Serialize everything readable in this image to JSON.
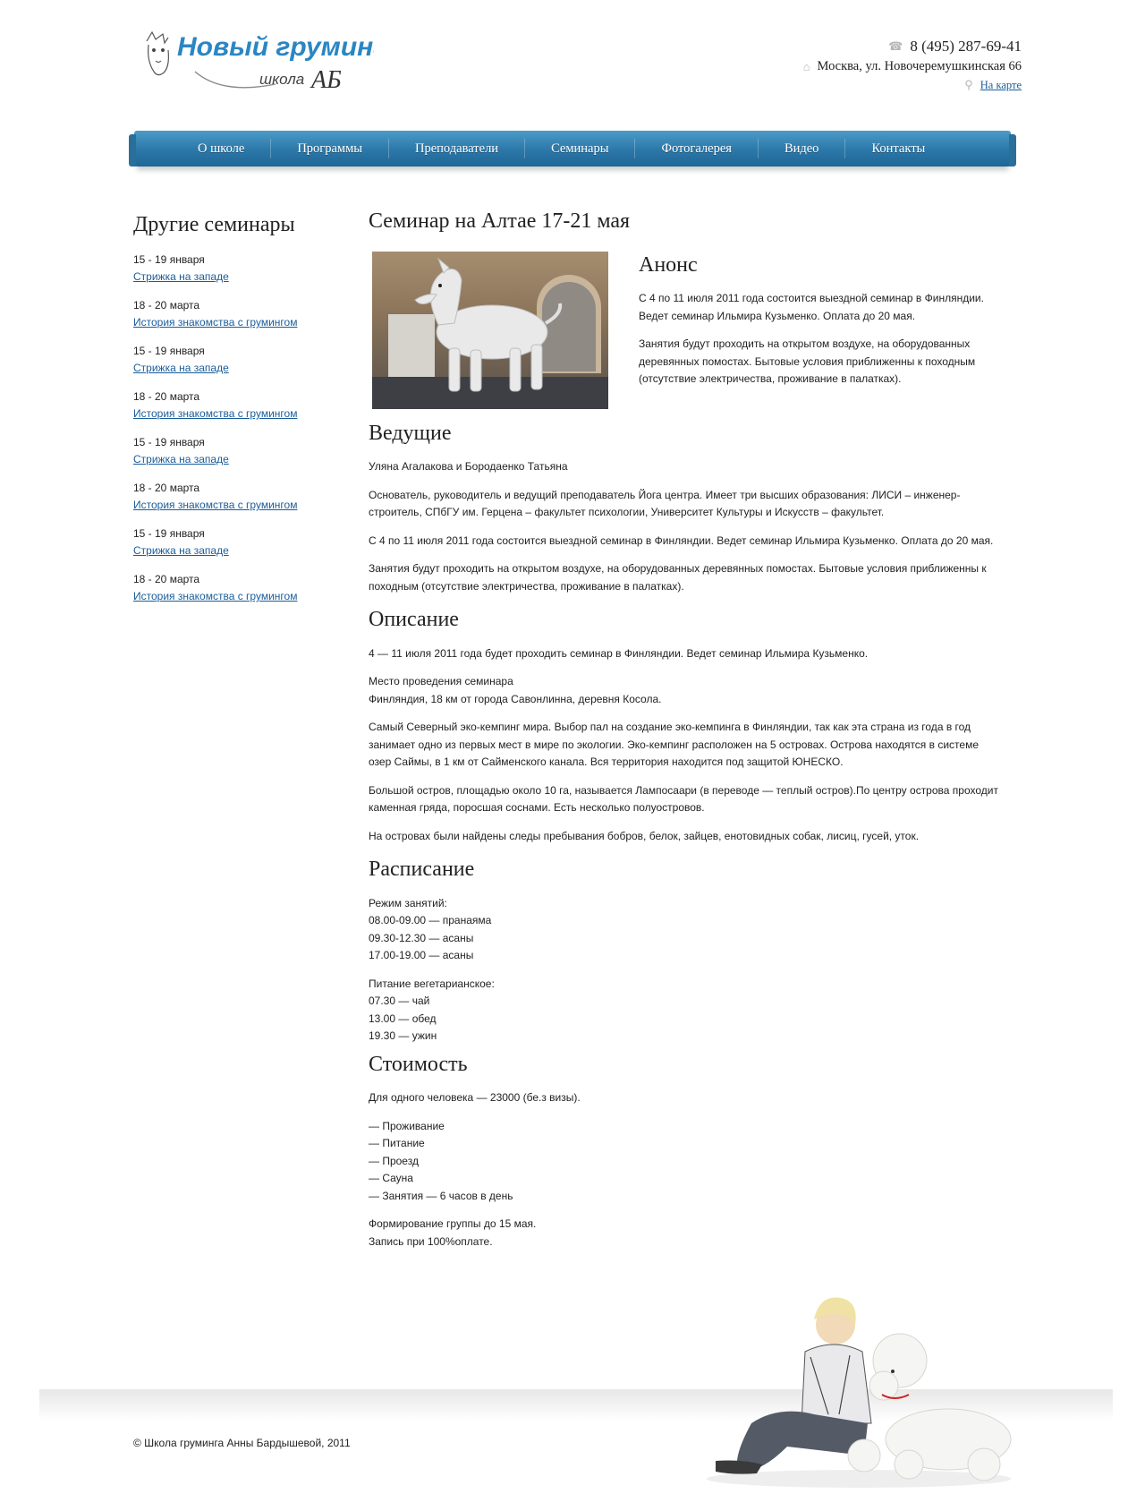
{
  "header": {
    "logo_title": "Новый груминг",
    "logo_subtitle": "школа",
    "logo_monogram": "АБ",
    "phone": "8 (495) 287-69-41",
    "address": "Москва, ул. Новочеремушкинская 66",
    "map_link": "На карте",
    "icons": [
      "phone-icon",
      "home-icon",
      "map-pin-icon"
    ]
  },
  "nav": {
    "items": [
      "О школе",
      "Программы",
      "Преподаватели",
      "Семинары",
      "Фотогалерея",
      "Видео",
      "Контакты"
    ]
  },
  "sidebar": {
    "title": "Другие семинары",
    "items": [
      {
        "date": "15 - 19 января",
        "link": "Стрижка на западе"
      },
      {
        "date": "18 - 20 марта",
        "link": "История знакомства с грумингом"
      },
      {
        "date": "15 - 19 января",
        "link": "Стрижка на западе"
      },
      {
        "date": "18 - 20 марта",
        "link": "История знакомства с грумингом"
      },
      {
        "date": "15 - 19 января",
        "link": "Стрижка на западе"
      },
      {
        "date": "18 - 20 марта",
        "link": "История знакомства с грумингом"
      },
      {
        "date": "15 - 19 января",
        "link": "Стрижка на западе"
      },
      {
        "date": "18 - 20 марта",
        "link": "История знакомства с грумингом"
      }
    ]
  },
  "content": {
    "title": "Семинар на Алтае 17-21 мая",
    "anons": {
      "heading": "Анонс",
      "p1": "С 4 по 11 июля 2011 года состоится выездной семинар в Финляндии. Ведет семинар Ильмира Кузьменко. Оплата до 20 мая.",
      "p2": "Занятия будут проходить на открытом воздухе, на оборудованных деревянных помостах. Бытовые условия приближенны к походным (отсутствие электричества, проживание в палатках)."
    },
    "hosts": {
      "heading": "Ведущие",
      "p1": "Уляна Агалакова и Бородаенко Татьяна",
      "p2": "Основатель, руководитель и ведущий преподаватель Йога центра. Имеет три высших образования: ЛИСИ – инженер-строитель, СПбГУ им. Герцена – факультет психологии, Университет Культуры и Искусств – факультет.",
      "p3": "С 4 по 11 июля 2011 года состоится выездной семинар в Финляндии. Ведет семинар Ильмира Кузьменко. Оплата до 20 мая.",
      "p4": "Занятия будут проходить на открытом воздухе, на оборудованных деревянных помостах. Бытовые условия приближенны к походным (отсутствие электричества, проживание в палатках)."
    },
    "description": {
      "heading": "Описание",
      "p1": "4 — 11 июля 2011 года будет проходить семинар в Финляндии. Ведет семинар Ильмира Кузьменко.",
      "p2_line1": "Место проведения семинара",
      "p2_line2": "Финляндия, 18 км от города Савонлинна, деревня Косола.",
      "p3": "Самый Северный эко-кемпинг мира. Выбор пал на создание эко-кемпинга в Финляндии, так как эта страна из года в год занимает одно из первых мест в мире по экологии. Эко-кемпинг расположен на 5 островах. Острова находятся в системе озер Саймы, в 1 км от Сайменского канала. Вся территория находится под защитой ЮНЕСКО.",
      "p4": "Большой остров, площадью около 10 га, называется Лампосаари (в переводе — теплый остров).По центру острова проходит каменная гряда, поросшая соснами. Есть несколько полуостровов.",
      "p5": "На островах были найдены следы пребывания бобров, белок, зайцев, енотовидных собак, лисиц, гусей, уток."
    },
    "schedule": {
      "heading": "Расписание",
      "mode_title": "Режим занятий:",
      "mode": [
        "08.00-09.00 — пранаяма",
        "09.30-12.30 — асаны",
        "17.00-19.00 — асаны"
      ],
      "food_title": "Питание вегетарианское:",
      "food": [
        "07.30 — чай",
        "13.00 — обед",
        "19.30 — ужин"
      ]
    },
    "price": {
      "heading": "Стоимость",
      "p1": "Для одного человека — 23000 (бе.з визы).",
      "includes": [
        "— Проживание",
        "— Питание",
        "— Проезд",
        "— Сауна",
        "— Занятия — 6 часов в день"
      ],
      "note1": "Формирование группы до 15 мая.",
      "note2": "Запись при 100%оплате."
    }
  },
  "footer": {
    "copyright": "© Школа груминга Анны Бардышевой, 2011"
  },
  "colors": {
    "nav": "#2b77a8",
    "link": "#1a5d9a",
    "logo_blue": "#2a86c4"
  }
}
